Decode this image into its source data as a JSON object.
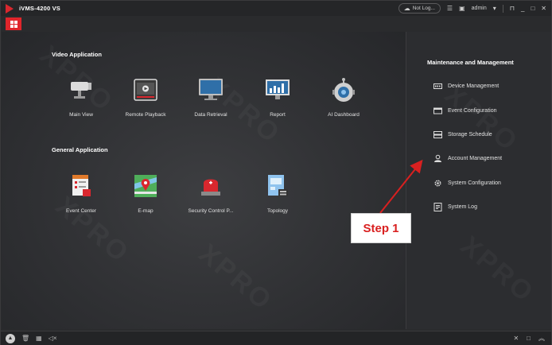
{
  "app": {
    "title": "iVMS-4200 VS"
  },
  "titlebar": {
    "network_status": "Not Log...",
    "user": "admin",
    "icons": [
      "cloud-icon",
      "menu-icon",
      "image-icon",
      "user-dropdown-icon",
      "lock-icon",
      "minimize-icon",
      "maximize-icon",
      "close-icon"
    ]
  },
  "video_application": {
    "title": "Video Application",
    "items": [
      {
        "label": "Main View",
        "icon": "camera-icon"
      },
      {
        "label": "Remote Playback",
        "icon": "playback-icon"
      },
      {
        "label": "Data Retrieval",
        "icon": "monitor-icon"
      },
      {
        "label": "Report",
        "icon": "report-chart-icon"
      },
      {
        "label": "AI Dashboard",
        "icon": "robot-icon"
      }
    ]
  },
  "general_application": {
    "title": "General Application",
    "items": [
      {
        "label": "Event Center",
        "icon": "event-center-icon"
      },
      {
        "label": "E-map",
        "icon": "map-pin-icon"
      },
      {
        "label": "Security Control P...",
        "icon": "alarm-light-icon"
      },
      {
        "label": "Topology",
        "icon": "topology-icon"
      }
    ]
  },
  "maintenance": {
    "title": "Maintenance and Management",
    "items": [
      {
        "label": "Device Management",
        "icon": "device-icon"
      },
      {
        "label": "Event Configuration",
        "icon": "event-config-icon"
      },
      {
        "label": "Storage Schedule",
        "icon": "storage-icon"
      },
      {
        "label": "Account Management",
        "icon": "account-icon"
      },
      {
        "label": "System Configuration",
        "icon": "gear-icon"
      },
      {
        "label": "System Log",
        "icon": "log-icon"
      }
    ]
  },
  "annotation": {
    "label": "Step 1",
    "color": "#d92020"
  },
  "watermark": {
    "text": "XPRO"
  },
  "colors": {
    "accent": "#e0252b",
    "background": "#2a2b2d"
  }
}
